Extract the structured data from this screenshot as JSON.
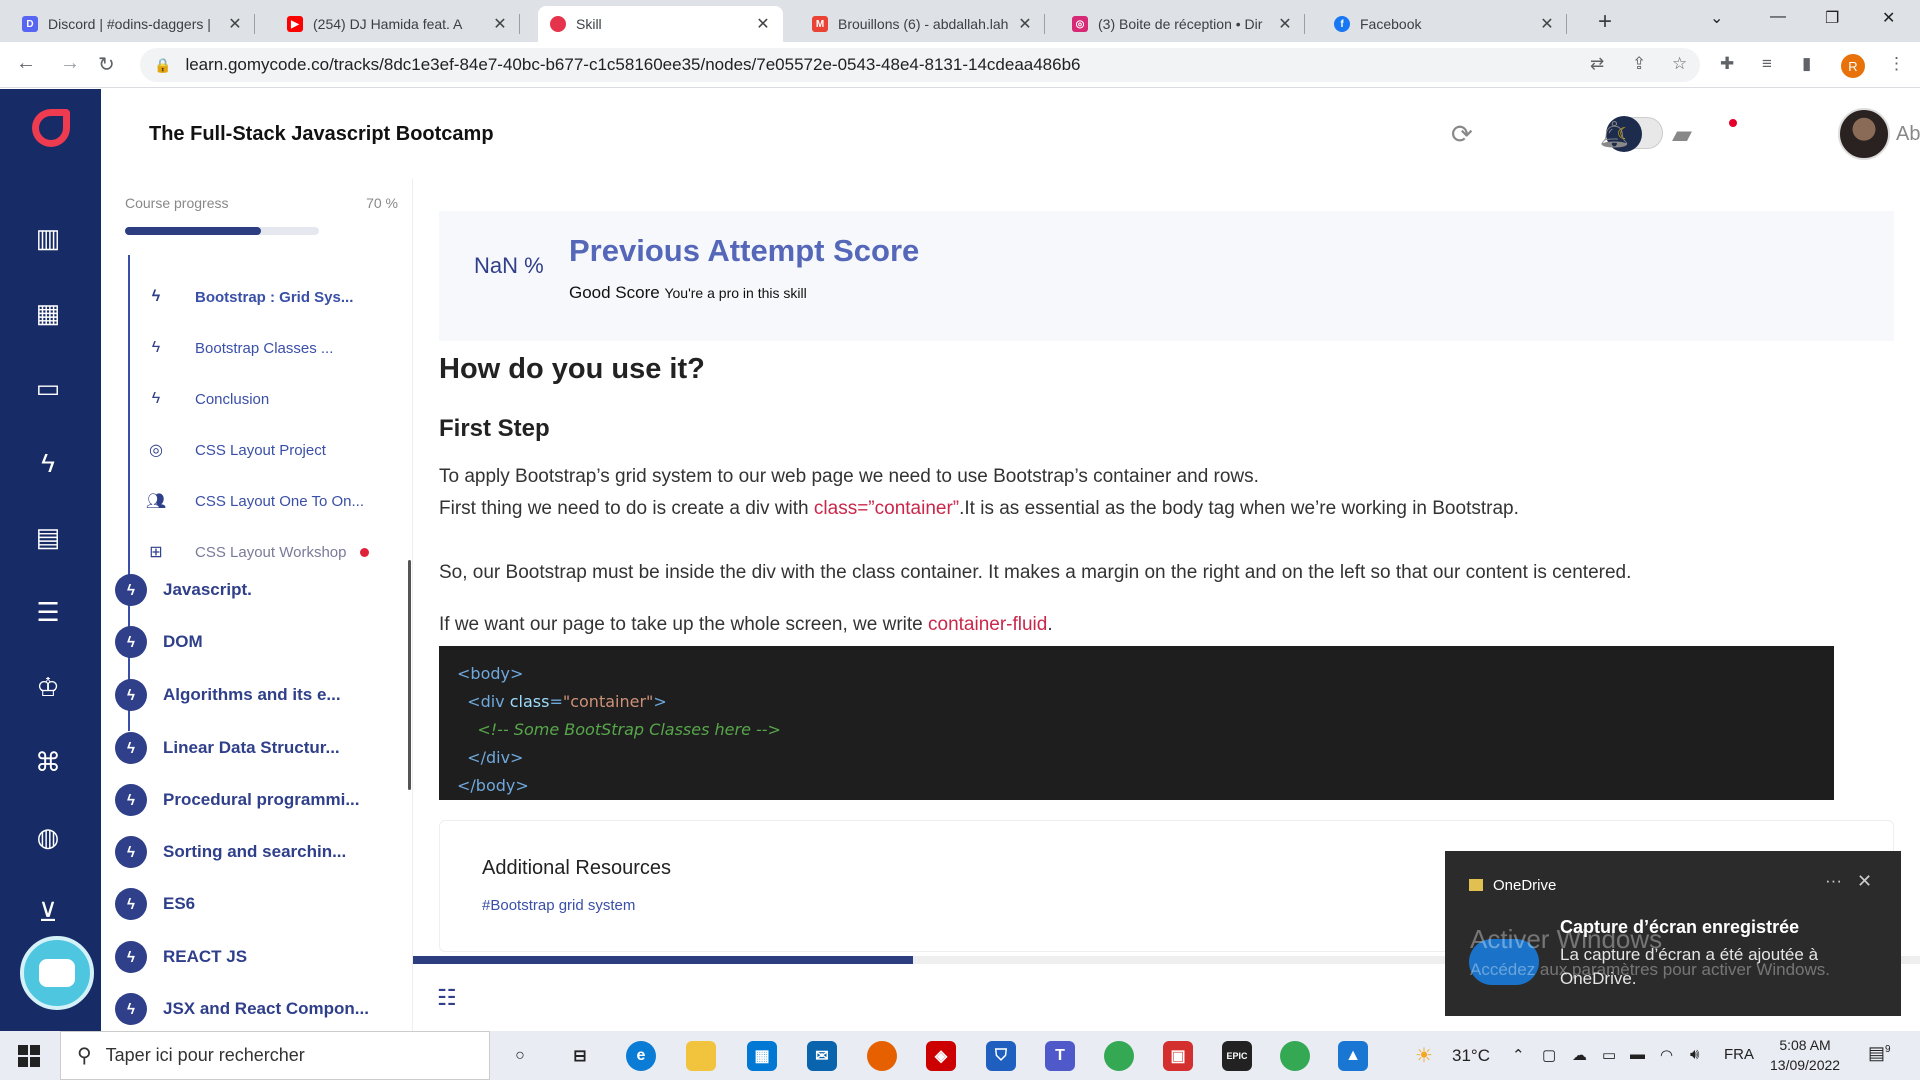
{
  "browser": {
    "tabs": [
      {
        "title": "Discord | #odins-daggers | ",
        "favicon": "discord-icon",
        "color": "#5865f2"
      },
      {
        "title": "(254) DJ Hamida feat. A",
        "favicon": "youtube-icon",
        "color": "#ff0000"
      },
      {
        "title": "Skill",
        "favicon": "gomycode-icon",
        "color": "#e5334b",
        "active": true
      },
      {
        "title": "Brouillons (6) - abdallah.lah",
        "favicon": "gmail-icon",
        "color": "#ea4335"
      },
      {
        "title": "(3) Boite de réception • Dir",
        "favicon": "instagram-icon",
        "color": "#d62976"
      },
      {
        "title": "Facebook",
        "favicon": "facebook-icon",
        "color": "#1877f2"
      }
    ],
    "url": "learn.gomycode.co/tracks/8dc1e3ef-84e7-40bc-b677-c1c58160ee35/nodes/7e05572e-0543-48e4-8131-14cdeaa486b6",
    "profile_initial": "R"
  },
  "header": {
    "course_title": "The Full-Stack Javascript Bootcamp",
    "username": "Abdallah"
  },
  "course_panel": {
    "progress_label": "Course progress",
    "progress_value": "70 %",
    "progress_fraction": 0.7,
    "sub_items": [
      {
        "label": "Bootstrap : Grid Sys...",
        "icon": "bolt-icon",
        "active": true
      },
      {
        "label": "Bootstrap Classes ...",
        "icon": "bolt-icon"
      },
      {
        "label": "Conclusion",
        "icon": "bolt-icon"
      },
      {
        "label": "CSS Layout Project",
        "icon": "target-icon"
      },
      {
        "label": "CSS Layout One To On...",
        "icon": "people-icon"
      },
      {
        "label": "CSS Layout Workshop",
        "icon": "workshop-icon",
        "faded": true,
        "dot": true
      }
    ],
    "modules": [
      "Javascript.",
      "DOM",
      "Algorithms and its e...",
      "Linear Data Structur...",
      "Procedural programmi...",
      "Sorting and searchin...",
      "ES6",
      "REACT JS",
      "JSX and React Compon..."
    ]
  },
  "score": {
    "percent": "NaN %",
    "title": "Previous Attempt Score",
    "good": "Good Score",
    "sub": "You're a pro in this skill"
  },
  "content": {
    "heading": "How do you use it?",
    "step": "First Step",
    "p1a": "To apply Bootstrap’s grid system to our web page we need to use Bootstrap’s container and rows.",
    "p1b_pre": "First thing we need to do is create a div with ",
    "p1b_code": "class=”container”",
    "p1b_post": ".It is as essential as the body tag when we’re working in Bootstrap.",
    "p2": "So, our Bootstrap must be inside the div with the class container. It makes a margin on the right and on the left so that our content is centered.",
    "p3_pre": "If we want our page to take up the whole screen, we write ",
    "p3_code": "container-fluid",
    "p3_post": ".",
    "code": {
      "l1": "<body>",
      "l2_tag_open": "<div ",
      "l2_attr": "class",
      "l2_eq": "=",
      "l2_str": "\"container\"",
      "l2_close": ">",
      "l3": "<!-- Some BootStrap Classes here -->",
      "l4": "</div>",
      "l5": "</body>"
    },
    "resources_title": "Additional Resources",
    "resources_link": "#Bootstrap grid system"
  },
  "toast": {
    "app": "OneDrive",
    "title": "Capture d’écran enregistrée",
    "body": "La capture d’écran a été ajoutée à OneDrive.",
    "watermark_title": "Activer Windows",
    "watermark_body": "Accédez aux paramètres pour activer Windows."
  },
  "taskbar": {
    "search_placeholder": "Taper ici pour rechercher",
    "weather": "31°C",
    "lang": "FRA",
    "time": "5:08 AM",
    "date": "13/09/2022",
    "notif_count": "9"
  }
}
